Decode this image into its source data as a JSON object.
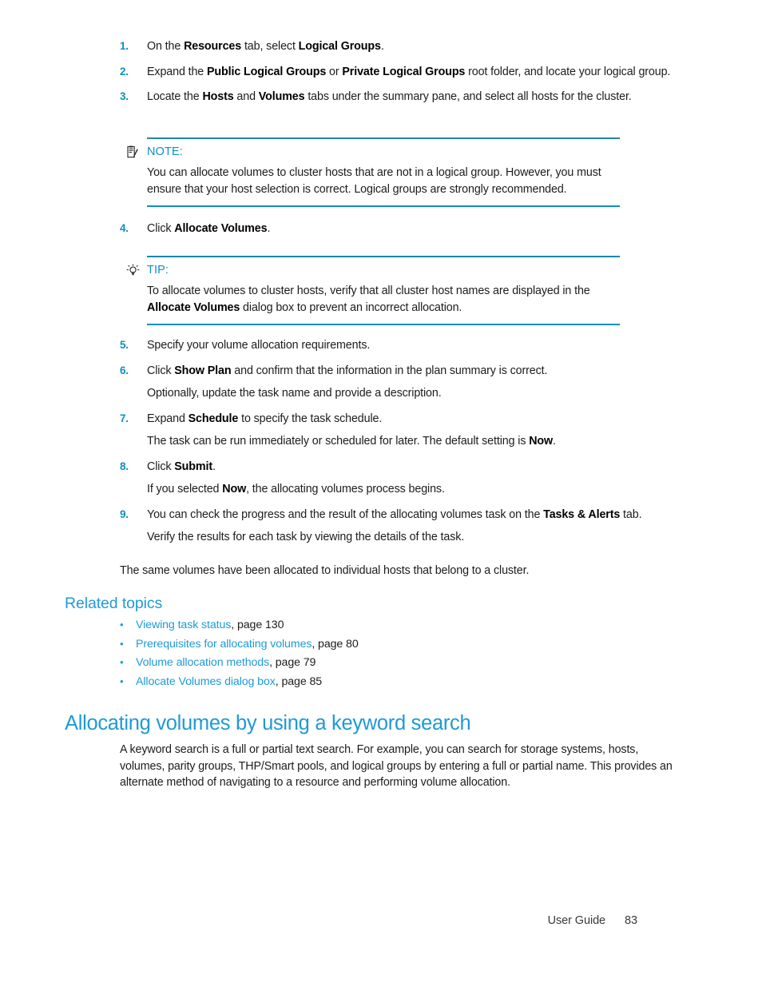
{
  "document": {
    "title": "User Guide",
    "page_number": "83",
    "accent_blue": "#1f9ad6",
    "rule_blue": "#1b87ae",
    "number_blue": "#0d8fc4"
  },
  "procedure": {
    "steps": [
      {
        "number": "1.",
        "parts": [
          {
            "t": "On the ",
            "b": false
          },
          {
            "t": "Resources",
            "b": true
          },
          {
            "t": " tab, select ",
            "b": false
          },
          {
            "t": "Logical Groups",
            "b": true
          },
          {
            "t": ".",
            "b": false
          }
        ]
      },
      {
        "number": "2.",
        "parts": [
          {
            "t": "Expand the ",
            "b": false
          },
          {
            "t": "Public Logical Groups",
            "b": true
          },
          {
            "t": " or ",
            "b": false
          },
          {
            "t": "Private Logical Groups",
            "b": true
          },
          {
            "t": " root folder, and locate your logical group.",
            "b": false
          }
        ]
      },
      {
        "number": "3.",
        "parts": [
          {
            "t": "Locate the ",
            "b": false
          },
          {
            "t": "Hosts",
            "b": true
          },
          {
            "t": " and ",
            "b": false
          },
          {
            "t": "Volumes",
            "b": true
          },
          {
            "t": " tabs under the summary pane, and select all hosts for the cluster.",
            "b": false
          }
        ]
      },
      {
        "number": "4.",
        "parts": [
          {
            "t": "Click ",
            "b": false
          },
          {
            "t": "Allocate Volumes",
            "b": true
          },
          {
            "t": ".",
            "b": false
          }
        ]
      },
      {
        "number": "5.",
        "parts": [
          {
            "t": "Specify your volume allocation requirements.",
            "b": false
          }
        ]
      },
      {
        "number": "6.",
        "parts": [
          {
            "t": "Click ",
            "b": false
          },
          {
            "t": "Show Plan",
            "b": true
          },
          {
            "t": " and confirm that the information in the plan summary is correct.",
            "b": false
          }
        ]
      },
      {
        "number": "7.",
        "parts": [
          {
            "t": "Expand ",
            "b": false
          },
          {
            "t": "Schedule",
            "b": true
          },
          {
            "t": " to specify the task schedule.",
            "b": false
          }
        ]
      },
      {
        "number": "8.",
        "parts": [
          {
            "t": "Click ",
            "b": false
          },
          {
            "t": "Submit",
            "b": true
          },
          {
            "t": ".",
            "b": false
          }
        ]
      },
      {
        "number": "9.",
        "parts": [
          {
            "t": "You can check the progress and the result of the allocating volumes task on the ",
            "b": false
          },
          {
            "t": "Tasks & Alerts",
            "b": true
          },
          {
            "t": " tab.",
            "b": false
          }
        ]
      }
    ],
    "sub_paragraphs": {
      "after_step6": [
        {
          "t": "Optionally, update the task name and provide a description.",
          "b": false
        }
      ],
      "after_step7": [
        {
          "t": "The task can be run immediately or scheduled for later. The default setting is ",
          "b": false
        },
        {
          "t": "Now",
          "b": true
        },
        {
          "t": ".",
          "b": false
        }
      ],
      "after_step8": [
        {
          "t": "If you selected ",
          "b": false
        },
        {
          "t": "Now",
          "b": true
        },
        {
          "t": ", the allocating volumes process begins.",
          "b": false
        }
      ],
      "after_step9": [
        {
          "t": "Verify the results for each task by viewing the details of the task.",
          "b": false
        }
      ]
    },
    "closing_paragraph": [
      {
        "t": "The same volumes have been allocated to individual hosts that belong to a cluster.",
        "b": false
      }
    ]
  },
  "note_box": {
    "icon": "note-clipboard-icon",
    "label": "NOTE:",
    "parts": [
      {
        "t": "You can allocate volumes to cluster hosts that are not in a logical group. However, you must ensure that your host selection is correct. Logical groups are strongly recommended.",
        "b": false
      }
    ]
  },
  "tip_box": {
    "icon": "tip-lightbulb-icon",
    "label": "TIP:",
    "parts": [
      {
        "t": "To allocate volumes to cluster hosts, verify that all cluster host names are displayed in the ",
        "b": false
      },
      {
        "t": "Allocate Volumes",
        "b": true
      },
      {
        "t": " dialog box to prevent an incorrect allocation.",
        "b": false
      }
    ]
  },
  "related_topics": {
    "heading": "Related topics",
    "bullet": "•",
    "items": [
      {
        "link": "Viewing task status",
        "page": ", page 130"
      },
      {
        "link": "Prerequisites for allocating volumes",
        "page": ", page 80"
      },
      {
        "link": "Volume allocation methods",
        "page": ", page 79"
      },
      {
        "link": "Allocate Volumes dialog box",
        "page": ", page 85"
      }
    ]
  },
  "section": {
    "heading": "Allocating volumes by using a keyword search",
    "paragraph": [
      {
        "t": "A keyword search is a full or partial text search. For example, you can search for storage systems, hosts, volumes, parity groups, THP/Smart pools, and logical groups by entering a full or partial name. This provides an alternate method of navigating to a resource and performing volume allocation.",
        "b": false
      }
    ]
  },
  "footer": {
    "guide_label": "User Guide",
    "page_number": "83"
  }
}
